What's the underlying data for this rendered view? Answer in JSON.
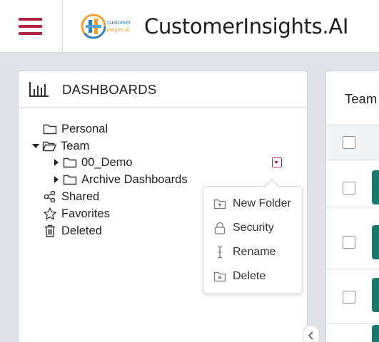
{
  "app": {
    "title": "CustomerInsights.AI",
    "logo_text_line1": "customer",
    "logo_text_line2": "insights.ai",
    "brand_color": "#b0243f",
    "accent_color": "#177a6b"
  },
  "dashboards_panel": {
    "title": "DASHBOARDS",
    "tree": [
      {
        "label": "Personal",
        "icon": "folder-icon"
      },
      {
        "label": "Team",
        "icon": "folder-open-icon",
        "expanded": true
      },
      {
        "label": "00_Demo",
        "icon": "folder-icon",
        "collapsed": true
      },
      {
        "label": "Archive Dashboards",
        "icon": "folder-icon",
        "collapsed": true
      },
      {
        "label": "Shared",
        "icon": "share-icon"
      },
      {
        "label": "Favorites",
        "icon": "star-icon"
      },
      {
        "label": "Deleted",
        "icon": "trash-icon"
      }
    ]
  },
  "context_menu": {
    "items": [
      {
        "label": "New Folder",
        "icon": "folder-plus-icon"
      },
      {
        "label": "Security",
        "icon": "lock-icon"
      },
      {
        "label": "Rename",
        "icon": "text-cursor-icon"
      },
      {
        "label": "Delete",
        "icon": "folder-delete-icon"
      }
    ]
  },
  "team_panel": {
    "title": "Team"
  }
}
